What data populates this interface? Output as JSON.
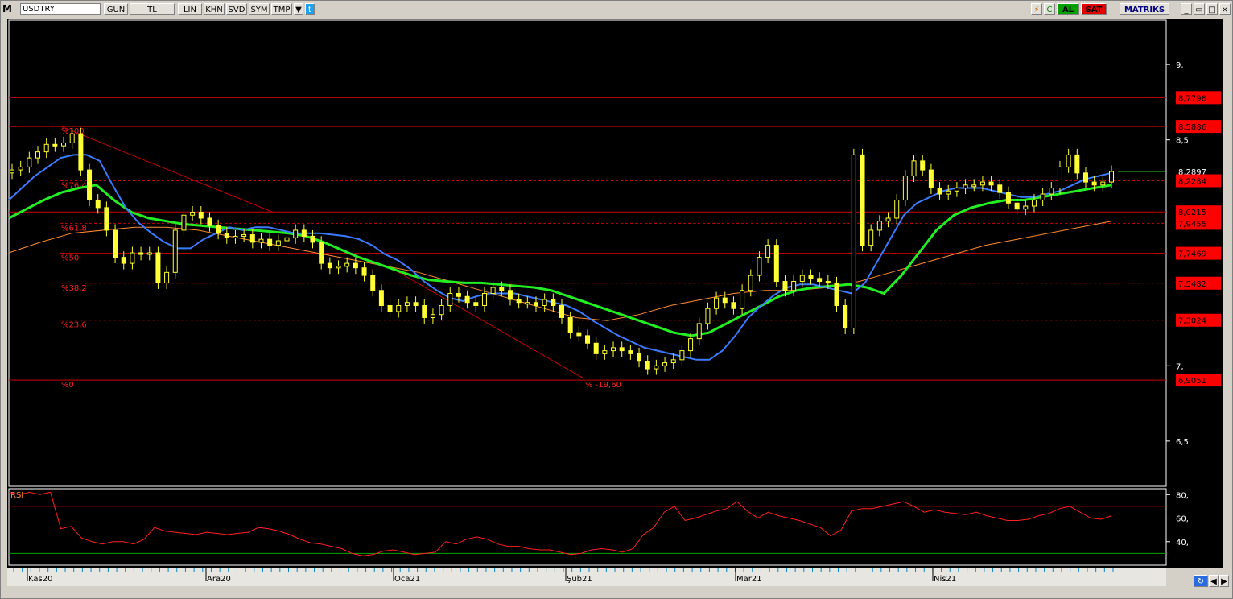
{
  "toolbar": {
    "logo": "M",
    "symbol": "USDTRY",
    "buttons": [
      "GUN",
      "TL",
      "LIN",
      "KHN",
      "SVD",
      "SYM",
      "TMP"
    ],
    "buy_label": "AL",
    "sell_label": "SAT",
    "brand": "MATRIKS"
  },
  "colors": {
    "background": "#000000",
    "candle": "#ffff33",
    "ma_fast": "#3a7bff",
    "ma_mid": "#22ee22",
    "ma_slow": "#ff8c33",
    "fib_line": "#cc0000",
    "rsi_line": "#ff2020",
    "label_bg": "#ff0000"
  },
  "chart_data": [
    {
      "type": "candlestick",
      "symbol": "USDTRY",
      "ylim": [
        6.2,
        9.3
      ],
      "y_ticks": [
        "9,",
        "8,5",
        "7,",
        "6,5"
      ],
      "x_ticks": [
        "Kas20",
        "Ara20",
        "Oca21",
        "Şub21",
        "Mar21",
        "Nis21"
      ],
      "fib_levels": [
        {
          "label": "%100",
          "price": 8.5886
        },
        {
          "label": "%76,4",
          "price": 8.2284
        },
        {
          "label": "%61,8",
          "price": 7.9455
        },
        {
          "label": "%50",
          "price": 7.7469
        },
        {
          "label": "%38,2",
          "price": 7.5482
        },
        {
          "label": "%23,6",
          "price": 7.3024
        },
        {
          "label": "%0",
          "price": 6.9051
        }
      ],
      "price_labels": [
        "8,7798",
        "8,5886",
        "8,2897",
        "8,2284",
        "8,0215",
        "7,9455",
        "7,7469",
        "7,5482",
        "7,3024",
        "6,9051"
      ],
      "top_line": 8.7798,
      "last_price": 8.2897,
      "support_line": 8.0215,
      "change_label": "% -19,60",
      "closes": [
        8.3,
        8.32,
        8.38,
        8.42,
        8.47,
        8.46,
        8.48,
        8.54,
        8.3,
        8.1,
        8.05,
        7.9,
        7.72,
        7.68,
        7.75,
        7.74,
        7.75,
        7.55,
        7.62,
        7.9,
        8.0,
        8.02,
        7.98,
        7.93,
        7.88,
        7.85,
        7.86,
        7.87,
        7.82,
        7.84,
        7.8,
        7.83,
        7.85,
        7.9,
        7.86,
        7.82,
        7.68,
        7.65,
        7.66,
        7.68,
        7.65,
        7.6,
        7.5,
        7.4,
        7.36,
        7.4,
        7.42,
        7.4,
        7.32,
        7.34,
        7.4,
        7.48,
        7.46,
        7.42,
        7.4,
        7.48,
        7.52,
        7.5,
        7.44,
        7.42,
        7.42,
        7.4,
        7.44,
        7.4,
        7.32,
        7.22,
        7.2,
        7.15,
        7.08,
        7.1,
        7.12,
        7.1,
        7.08,
        7.03,
        6.98,
        7.0,
        7.02,
        7.04,
        7.1,
        7.18,
        7.28,
        7.38,
        7.45,
        7.42,
        7.38,
        7.5,
        7.6,
        7.72,
        7.8,
        7.56,
        7.5,
        7.56,
        7.6,
        7.58,
        7.56,
        7.55,
        7.4,
        7.25,
        8.4,
        7.8,
        7.9,
        7.96,
        7.98,
        8.1,
        8.26,
        8.36,
        8.3,
        8.18,
        8.14,
        8.16,
        8.18,
        8.2,
        8.2,
        8.22,
        8.2,
        8.15,
        8.08,
        8.04,
        8.06,
        8.1,
        8.14,
        8.18,
        8.32,
        8.4,
        8.28,
        8.22,
        8.2,
        8.22,
        8.2897
      ],
      "ma_fast": [
        8.1,
        8.18,
        8.26,
        8.32,
        8.38,
        8.4,
        8.4,
        8.36,
        8.2,
        8.05,
        7.95,
        7.88,
        7.82,
        7.78,
        7.78,
        7.84,
        7.88,
        7.92,
        7.9,
        7.92,
        7.92,
        7.9,
        7.88,
        7.88,
        7.88,
        7.87,
        7.86,
        7.84,
        7.8,
        7.74,
        7.7,
        7.64,
        7.56,
        7.5,
        7.45,
        7.43,
        7.46,
        7.48,
        7.48,
        7.48,
        7.46,
        7.44,
        7.42,
        7.4,
        7.36,
        7.3,
        7.25,
        7.2,
        7.16,
        7.12,
        7.1,
        7.08,
        7.06,
        7.04,
        7.04,
        7.1,
        7.2,
        7.32,
        7.4,
        7.47,
        7.52,
        7.54,
        7.54,
        7.52,
        7.5,
        7.48,
        7.55,
        7.7,
        7.85,
        8.0,
        8.08,
        8.12,
        8.16,
        8.18,
        8.18,
        8.18,
        8.16,
        8.14,
        8.12,
        8.12,
        8.14,
        8.16,
        8.2,
        8.24,
        8.26,
        8.28
      ],
      "ma_mid": [
        7.98,
        8.04,
        8.1,
        8.15,
        8.18,
        8.2,
        8.1,
        8.02,
        7.98,
        7.96,
        7.94,
        7.93,
        7.92,
        7.91,
        7.9,
        7.89,
        7.88,
        7.86,
        7.82,
        7.77,
        7.72,
        7.68,
        7.64,
        7.6,
        7.57,
        7.56,
        7.55,
        7.55,
        7.54,
        7.53,
        7.52,
        7.5,
        7.46,
        7.42,
        7.38,
        7.34,
        7.3,
        7.26,
        7.22,
        7.2,
        7.22,
        7.28,
        7.34,
        7.4,
        7.46,
        7.5,
        7.52,
        7.53,
        7.54,
        7.52,
        7.48,
        7.6,
        7.75,
        7.9,
        8.0,
        8.05,
        8.08,
        8.1,
        8.1,
        8.12,
        8.14,
        8.16,
        8.18,
        8.2
      ],
      "ma_slow": [
        7.75,
        7.82,
        7.88,
        7.9,
        7.92,
        7.92,
        7.9,
        7.86,
        7.82,
        7.78,
        7.74,
        7.7,
        7.66,
        7.62,
        7.56,
        7.5,
        7.44,
        7.38,
        7.32,
        7.3,
        7.34,
        7.4,
        7.44,
        7.48,
        7.5,
        7.5,
        7.52,
        7.56,
        7.62,
        7.68,
        7.74,
        7.8,
        7.84,
        7.88,
        7.92,
        7.96
      ],
      "rsi_values": [
        82,
        80,
        82,
        80,
        82,
        51,
        53,
        43,
        40,
        38,
        40,
        40,
        38,
        42,
        52,
        49,
        48,
        47,
        46,
        48,
        47,
        46,
        47,
        48,
        52,
        51,
        49,
        46,
        42,
        39,
        38,
        36,
        34,
        30,
        28,
        29,
        32,
        33,
        31,
        29,
        30,
        31,
        40,
        38,
        42,
        44,
        42,
        38,
        36,
        36,
        34,
        33,
        33,
        31,
        29,
        30,
        33,
        34,
        33,
        31,
        34,
        46,
        52,
        65,
        70,
        58,
        60,
        63,
        66,
        68,
        74,
        66,
        60,
        65,
        62,
        60,
        58,
        55,
        52,
        45,
        50,
        66,
        68,
        68,
        70,
        72,
        74,
        70,
        65,
        67,
        65,
        64,
        63,
        65,
        62,
        60,
        58,
        58,
        59,
        62,
        64,
        68,
        70,
        65,
        60,
        59,
        62
      ],
      "rsi_label": "RSI",
      "rsi_levels": [
        70,
        30
      ],
      "rsi_ticks": [
        "80,",
        "60,",
        "40,"
      ],
      "rsi_ylim": [
        20,
        85
      ]
    }
  ]
}
